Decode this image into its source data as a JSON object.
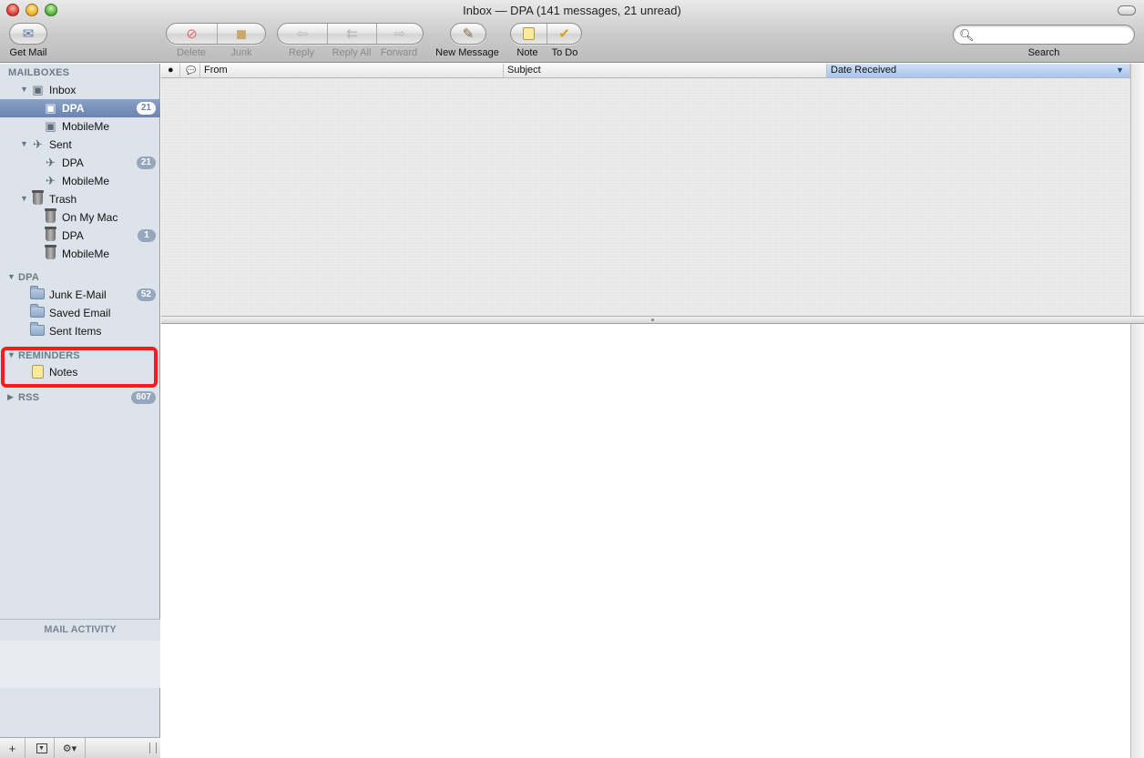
{
  "window": {
    "title": "Inbox — DPA (141 messages,  21 unread)"
  },
  "toolbar": {
    "get_mail": "Get Mail",
    "delete": "Delete",
    "junk": "Junk",
    "reply": "Reply",
    "reply_all": "Reply All",
    "forward": "Forward",
    "new_message": "New Message",
    "note": "Note",
    "todo": "To Do",
    "search_label": "Search",
    "search_value": ""
  },
  "sidebar": {
    "mailboxes_header": "MAILBOXES",
    "inbox": {
      "label": "Inbox",
      "children": [
        {
          "label": "DPA",
          "badge": "21",
          "selected": true
        },
        {
          "label": "MobileMe",
          "badge": ""
        }
      ]
    },
    "sent": {
      "label": "Sent",
      "children": [
        {
          "label": "DPA",
          "badge": "21"
        },
        {
          "label": "MobileMe",
          "badge": ""
        }
      ]
    },
    "trash": {
      "label": "Trash",
      "children": [
        {
          "label": "On My Mac",
          "badge": ""
        },
        {
          "label": "DPA",
          "badge": "1"
        },
        {
          "label": "MobileMe",
          "badge": ""
        }
      ]
    },
    "dpa_header": "DPA",
    "dpa_folders": [
      {
        "label": "Junk E-Mail",
        "badge": "52"
      },
      {
        "label": "Saved Email",
        "badge": ""
      },
      {
        "label": "Sent Items",
        "badge": ""
      }
    ],
    "reminders_header": "REMINDERS",
    "reminders_items": [
      {
        "label": "Notes"
      }
    ],
    "rss_header": "RSS",
    "rss_badge": "607",
    "activity_header": "MAIL ACTIVITY",
    "footer": {
      "add": "+",
      "gear": "⚙▾"
    }
  },
  "message_list": {
    "columns": {
      "unread": "●",
      "flag": "💬",
      "from": "From",
      "subject": "Subject",
      "date": "Date Received"
    }
  },
  "colors": {
    "selection": "#6a84b2",
    "sidebar_bg": "#dde3ea",
    "highlight_box": "#ff1a1a",
    "sorted_column": "#a9c5ec"
  }
}
